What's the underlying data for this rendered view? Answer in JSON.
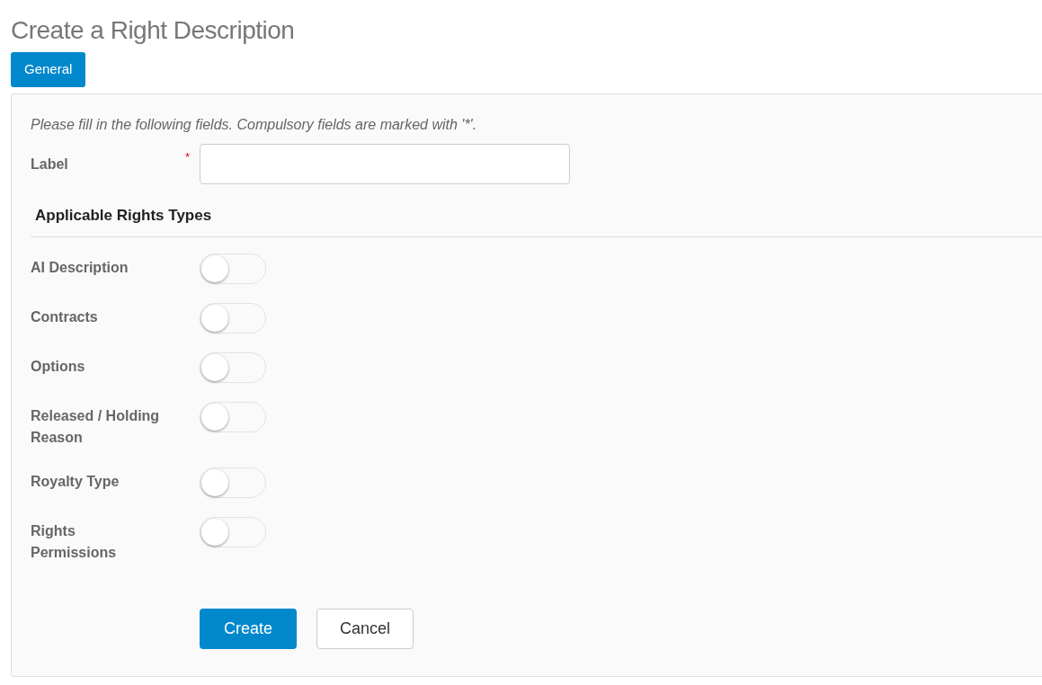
{
  "page": {
    "title": "Create a Right Description"
  },
  "tabs": [
    {
      "label": "General",
      "selected": true
    }
  ],
  "form": {
    "instructions": "Please fill in the following fields. Compulsory fields are marked with '*'.",
    "label_field": {
      "label": "Label",
      "required": true,
      "required_mark": "*"
    },
    "section_title": "Applicable Rights Types",
    "toggles": [
      {
        "label": "AI Description",
        "on": false
      },
      {
        "label": "Contracts",
        "on": false
      },
      {
        "label": "Options",
        "on": false
      },
      {
        "label": "Released / Holding Reason",
        "on": false
      },
      {
        "label": "Royalty Type",
        "on": false
      },
      {
        "label": "Rights Permissions",
        "on": false
      }
    ],
    "buttons": [
      {
        "label": "Create",
        "kind": "primary"
      },
      {
        "label": "Cancel",
        "kind": "secondary"
      }
    ]
  }
}
